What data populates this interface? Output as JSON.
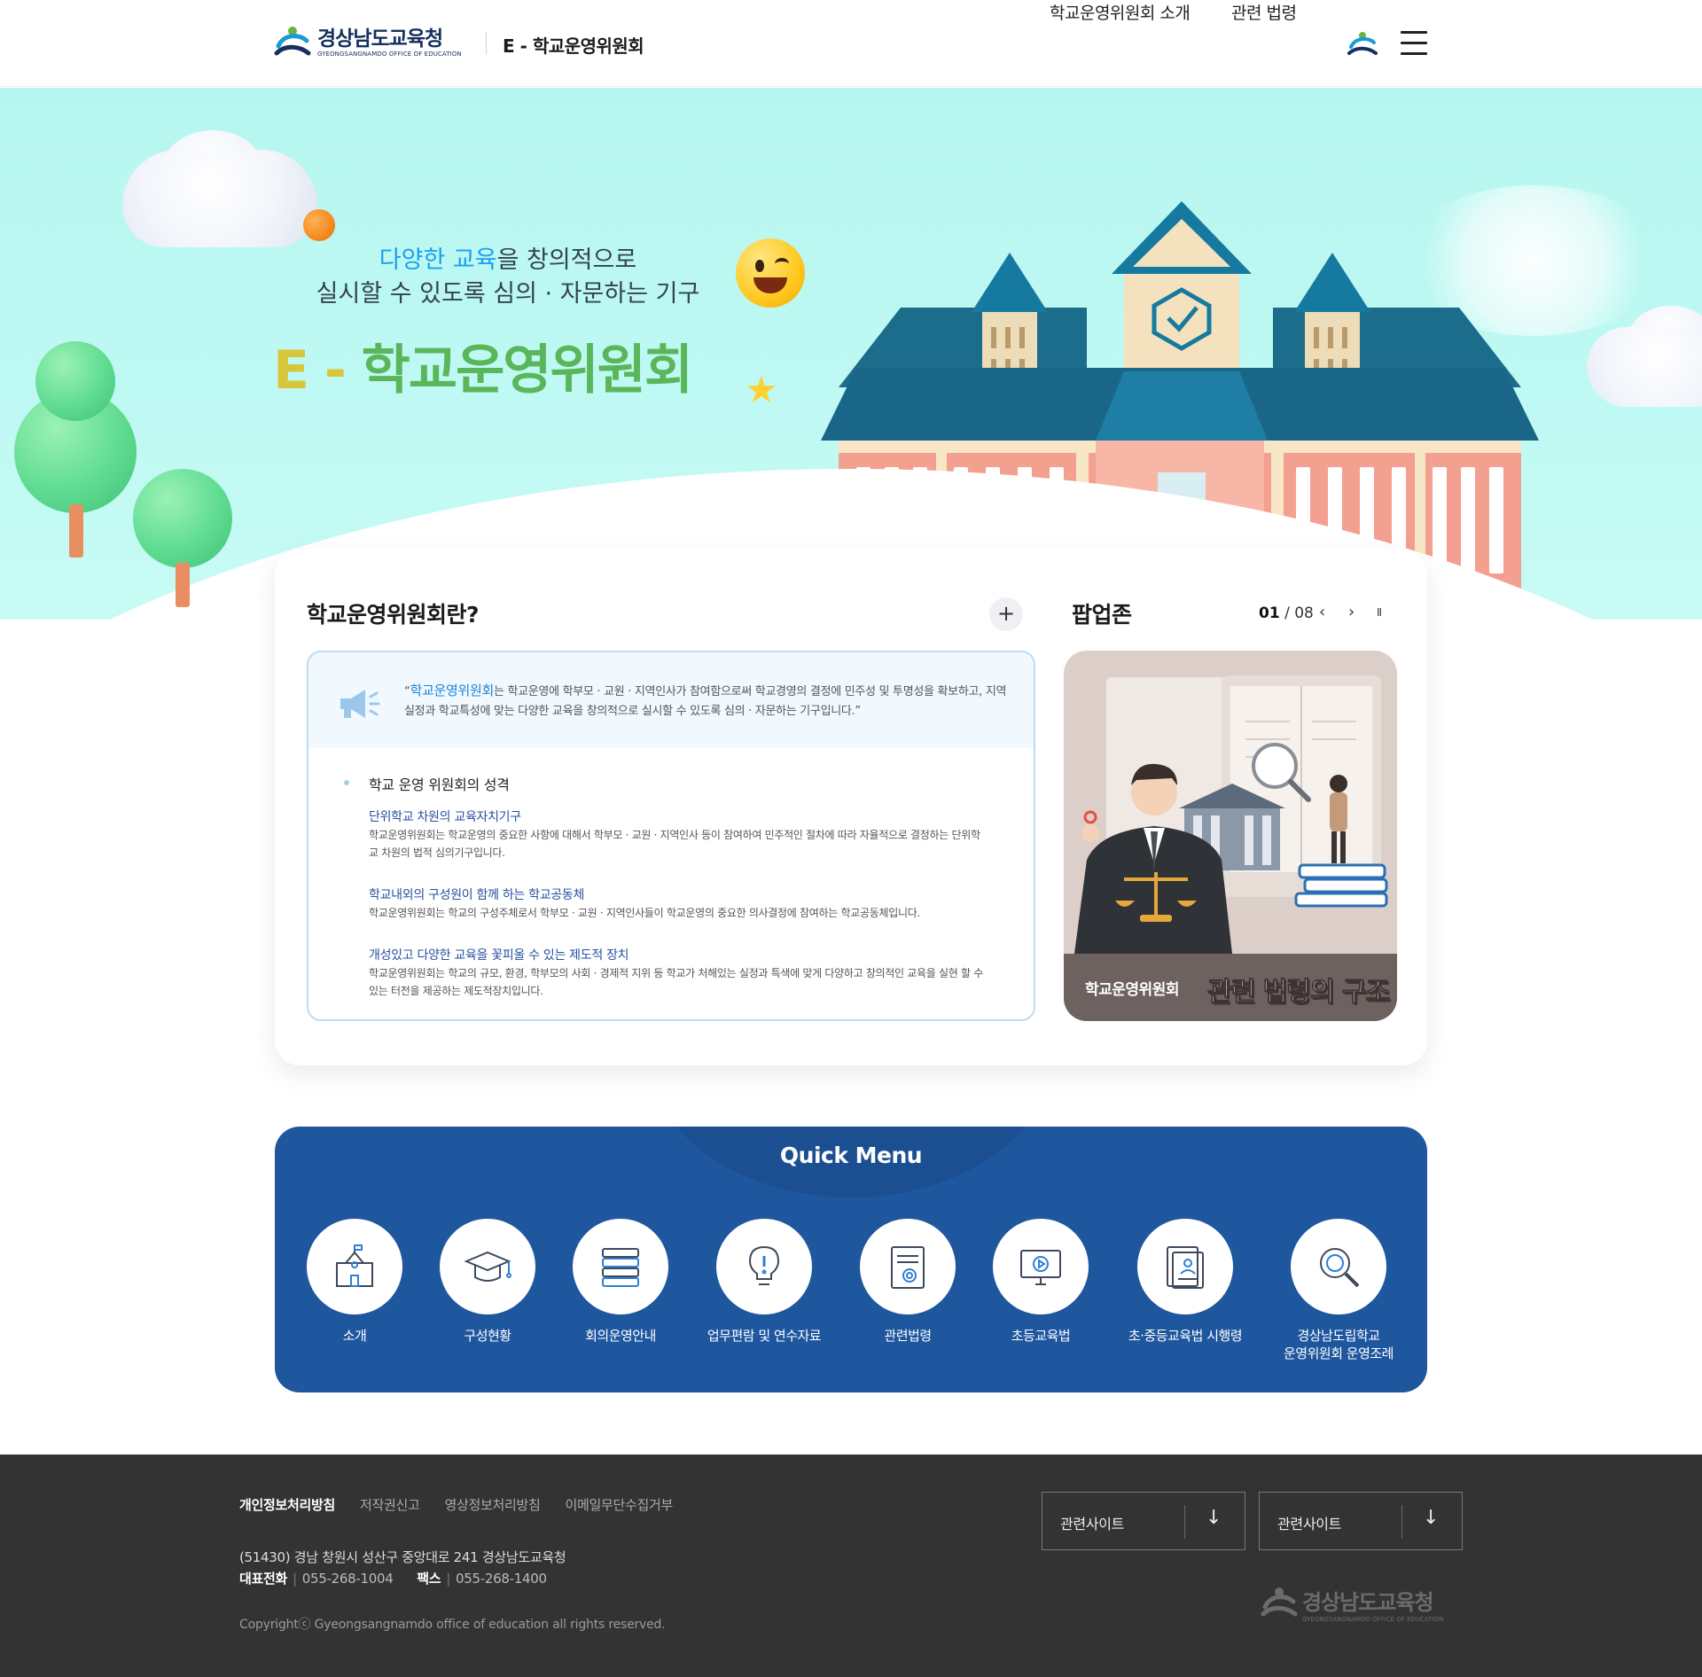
{
  "header": {
    "logo_ko": "경상남도교육청",
    "logo_en": "GYEONGSANGNAMDO OFFICE OF EDUCATION",
    "site_title": "E - 학교운영위원회",
    "nav": [
      "학교운영위원회 소개",
      "관련 법령"
    ],
    "menu_icon": "hamburger-icon"
  },
  "hero": {
    "sub_line1_highlight": "다양한 교육",
    "sub_line1_rest": "을 창의적으로",
    "sub_line2": "실시할 수 있도록 심의 · 자문하는 기구",
    "title_e": "E - ",
    "title_main": "학교운영위원회"
  },
  "intro": {
    "title": "학교운영위원회란?",
    "more_label": "+",
    "quote_open": "“",
    "quote_keyword": "학교운영위원회",
    "quote_text": "는 학교운영에 학부모 · 교원 · 지역인사가 참여함으로써 학교경영의 결정에 민주성 및 투명성을 확보하고, 지역실정과 학교특성에 맞는 다양한 교육을 창의적으로 실시할 수 있도록 심의 · 자문하는 기구입니다.”",
    "section_head": "학교 운영 위원회의 성격",
    "items": [
      {
        "title": "단위학교 차원의 교육자치기구",
        "text": "학교운영위원회는 학교운영의 중요한 사항에 대해서 학부모 · 교원 · 지역인사 등이 참여하여 민주적인 절차에 따라 자율적으로 결정하는 단위학교 차원의 법적 심의기구입니다."
      },
      {
        "title": "학교내외의 구성원이 함께 하는 학교공동체",
        "text": "학교운영위원회는 학교의 구성주체로서 학부모 · 교원 · 지역인사들이 학교운영의 중요한 의사결정에 참여하는 학교공동체입니다."
      },
      {
        "title": "개성있고 다양한 교육을 꽃피울 수 있는 제도적 장치",
        "text": "학교운영위원회는 학교의 규모, 환경, 학부모의 사회 · 경제적 지위 등 학교가 처해있는 실정과 특색에 맞게 다양하고 창의적인 교육을 실현 할 수 있는 터전을 제공하는 제도적장치입니다."
      }
    ]
  },
  "popup": {
    "title": "팝업존",
    "current": "01",
    "total": "/ 08",
    "prev": "‹",
    "next": "›",
    "pause": "II",
    "caption_small": "학교운영위원회",
    "caption_big": "관련 법령의 구조"
  },
  "quick_menu": {
    "title": "Quick Menu",
    "items": [
      {
        "label": "소개",
        "icon": "school-icon"
      },
      {
        "label": "구성현황",
        "icon": "graduation-cap-icon"
      },
      {
        "label": "회의운영안내",
        "icon": "books-icon"
      },
      {
        "label": "업무편람 및 연수자료",
        "icon": "lightbulb-icon"
      },
      {
        "label": "관련법령",
        "icon": "certificate-icon"
      },
      {
        "label": "초등교육법",
        "icon": "monitor-play-icon"
      },
      {
        "label": "초·중등교육법 시행령",
        "icon": "document-user-icon"
      },
      {
        "label": "경상남도립학교\n운영위원회 운영조례",
        "icon": "magnifier-icon"
      }
    ]
  },
  "footer": {
    "links": [
      "개인정보처리방침",
      "저작권신고",
      "영상정보처리방침",
      "이메일무단수집거부"
    ],
    "address": "(51430) 경남 창원시 성산구 중앙대로 241 경상남도교육청",
    "phone_label": "대표전화",
    "phone": "055-268-1004",
    "fax_label": "팩스",
    "fax": "055-268-1400",
    "copyright": "Copyrightⓒ Gyeongsangnamdo office of education all rights reserved.",
    "related_sites": [
      "관련사이트",
      "관련사이트"
    ],
    "logo_ko": "경상남도교육청",
    "logo_en": "GYEONGSANGNAMDO OFFICE OF EDUCATION"
  },
  "colors": {
    "hero_bg": "#b7f6f0",
    "quick_bg": "#1f579f",
    "footer_bg": "#333333",
    "accent_blue": "#1b86d8",
    "item_title": "#2650a0"
  }
}
